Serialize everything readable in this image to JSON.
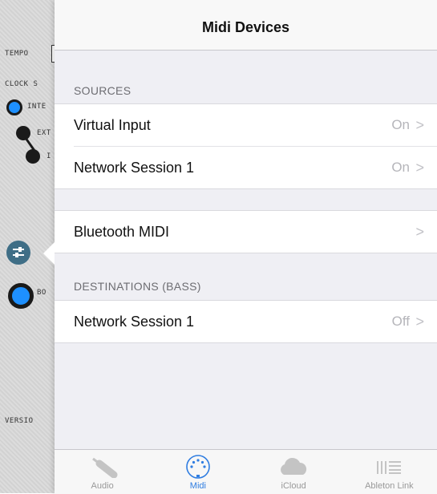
{
  "background_app": {
    "tempo_label": "TEMPO",
    "clock_label": "CLOCK S",
    "opt1": "INTE",
    "opt2": "EXT",
    "opt3": "I",
    "bo_label": "BO",
    "version_label": "VERSIO"
  },
  "popover": {
    "title": "Midi Devices",
    "sources_header": "SOURCES",
    "sources": [
      {
        "label": "Virtual Input",
        "value": "On"
      },
      {
        "label": "Network Session 1",
        "value": "On"
      }
    ],
    "bluetooth": {
      "label": "Bluetooth MIDI",
      "value": ""
    },
    "destinations_header": "DESTINATIONS (BASS)",
    "destinations": [
      {
        "label": "Network Session 1",
        "value": "Off"
      }
    ]
  },
  "tabbar": {
    "tabs": [
      {
        "label": "Audio",
        "icon": "audio-cable-icon",
        "active": false
      },
      {
        "label": "Midi",
        "icon": "midi-connector-icon",
        "active": true
      },
      {
        "label": "iCloud",
        "icon": "cloud-icon",
        "active": false
      },
      {
        "label": "Ableton Link",
        "icon": "ableton-link-icon",
        "active": false
      }
    ]
  },
  "colors": {
    "accent": "#2f7de1",
    "secondary_text": "#b5b5ba",
    "section_header": "#6d6d72"
  }
}
